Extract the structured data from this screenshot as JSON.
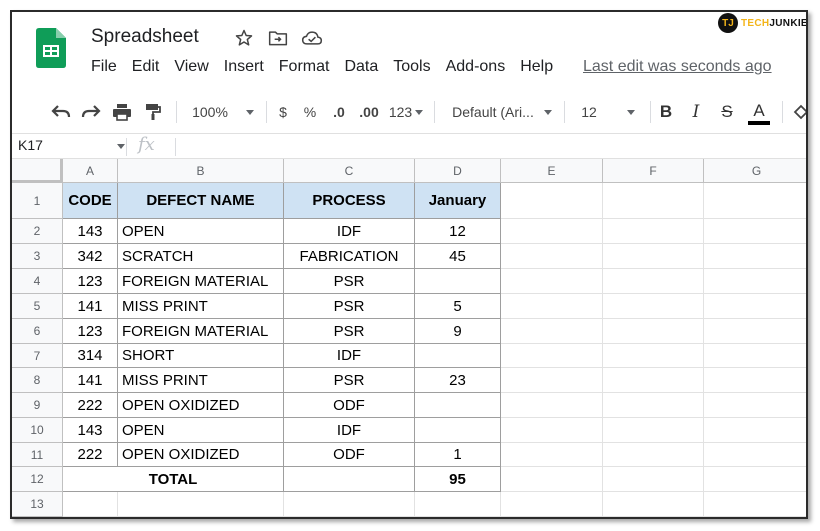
{
  "header": {
    "title": "Spreadsheet",
    "icons": [
      "star-icon",
      "move-folder-icon",
      "cloud-status-icon"
    ],
    "menu": [
      "File",
      "Edit",
      "View",
      "Insert",
      "Format",
      "Data",
      "Tools",
      "Add-ons",
      "Help"
    ],
    "last_edit": "Last edit was seconds ago"
  },
  "watermark": {
    "badge": "TJ",
    "tech": "TECH",
    "junkie": "JUNKIE"
  },
  "toolbar": {
    "zoom": "100%",
    "currency": "$",
    "percent": "%",
    "decrease_decimals": ".0",
    "increase_decimals": ".00",
    "more_formats": "123",
    "font": "Default (Ari...",
    "font_size": "12",
    "bold": "B",
    "italic": "I",
    "strikethrough": "S",
    "text_color": "A"
  },
  "formula_bar": {
    "name_box": "K17",
    "fx": "fx",
    "value": ""
  },
  "colors": {
    "header_fill": "#cfe2f3",
    "sheets_green": "#0f9d58"
  },
  "grid": {
    "columns": [
      "A",
      "B",
      "C",
      "D",
      "E",
      "F",
      "G"
    ],
    "rows": [
      "1",
      "2",
      "3",
      "4",
      "5",
      "6",
      "7",
      "8",
      "9",
      "10",
      "11",
      "12",
      "13"
    ],
    "table_header": [
      "CODE",
      "DEFECT NAME",
      "PROCESS",
      "January"
    ],
    "table_rows": [
      [
        "143",
        "OPEN",
        "IDF",
        "12"
      ],
      [
        "342",
        "SCRATCH",
        "FABRICATION",
        "45"
      ],
      [
        "123",
        "FOREIGN MATERIAL",
        "PSR",
        ""
      ],
      [
        "141",
        "MISS PRINT",
        "PSR",
        "5"
      ],
      [
        "123",
        "FOREIGN MATERIAL",
        "PSR",
        "9"
      ],
      [
        "314",
        "SHORT",
        "IDF",
        ""
      ],
      [
        "141",
        "MISS PRINT",
        "PSR",
        "23"
      ],
      [
        "222",
        "OPEN OXIDIZED",
        "ODF",
        ""
      ],
      [
        "143",
        "OPEN",
        "IDF",
        ""
      ],
      [
        "222",
        "OPEN OXIDIZED",
        "ODF",
        "1"
      ]
    ],
    "total_label": "TOTAL",
    "total_value": "95"
  }
}
